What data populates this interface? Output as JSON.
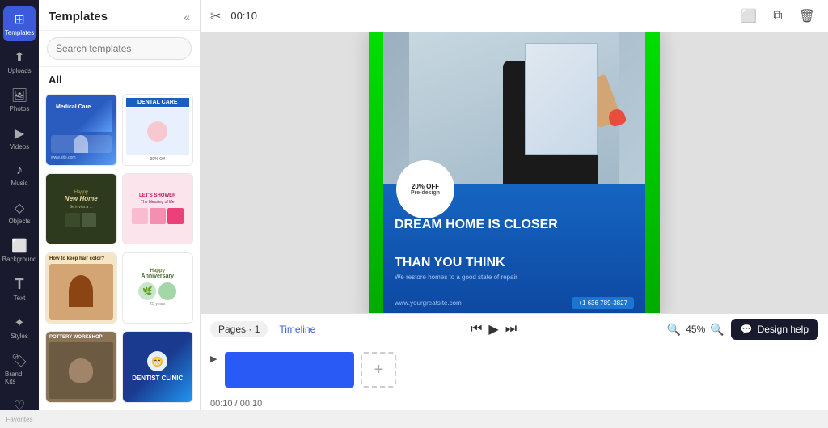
{
  "nav": {
    "items": [
      {
        "id": "templates",
        "label": "Templates",
        "icon": "⊞",
        "active": true
      },
      {
        "id": "uploads",
        "label": "Uploads",
        "icon": "⬆"
      },
      {
        "id": "photos",
        "label": "Photos",
        "icon": "🖼"
      },
      {
        "id": "videos",
        "label": "Videos",
        "icon": "▶"
      },
      {
        "id": "music",
        "label": "Music",
        "icon": "♪"
      },
      {
        "id": "objects",
        "label": "Objects",
        "icon": "◇"
      },
      {
        "id": "background",
        "label": "Background",
        "icon": "⬜"
      },
      {
        "id": "text",
        "label": "Text",
        "icon": "T"
      },
      {
        "id": "styles",
        "label": "Styles",
        "icon": "✦"
      },
      {
        "id": "brand-kits",
        "label": "Brand Kits",
        "icon": "🏷"
      },
      {
        "id": "favorites",
        "label": "Favorites",
        "icon": "♡"
      }
    ]
  },
  "templates_panel": {
    "title": "Templates",
    "search_placeholder": "Search templates",
    "all_label": "All",
    "templates": [
      {
        "id": "medical",
        "label": "Medical Care"
      },
      {
        "id": "dental",
        "label": "Dental Care"
      },
      {
        "id": "happy",
        "label": "Happy New Home"
      },
      {
        "id": "shower",
        "label": "Let's Shower"
      },
      {
        "id": "hair",
        "label": "How to keep hair color?"
      },
      {
        "id": "anniversary",
        "label": "Happy Anniversary"
      },
      {
        "id": "pottery",
        "label": "Pottery Workshop"
      },
      {
        "id": "dentist",
        "label": "Dentist Clinic"
      }
    ]
  },
  "toolbar": {
    "time": "00:10"
  },
  "canvas": {
    "badge": {
      "line1": "20% OFF",
      "line2": "Pre-design"
    },
    "headline_line1": "DREAM HOME IS CLOSER",
    "headline_line2": "THAN YOU THINK",
    "subtext": "We restore homes to a good state of repair",
    "url": "www.yourgreatsite.com",
    "phone": "+1 636 789-3827"
  },
  "timeline": {
    "pages_label": "Pages · 1",
    "timeline_label": "Timeline",
    "zoom": "45%",
    "time_display": "00:10 / 00:10",
    "plus_label": "+"
  },
  "design_help": {
    "label": "Design help",
    "icon": "💬"
  }
}
